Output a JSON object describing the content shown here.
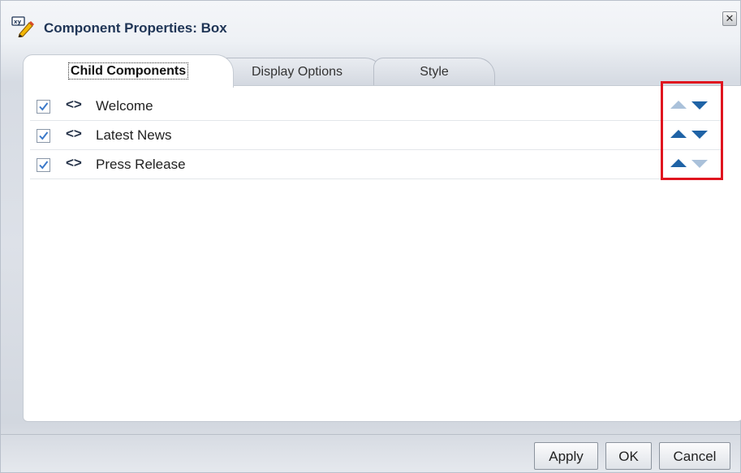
{
  "dialog": {
    "title": "Component Properties: Box",
    "title_icon": "edit-properties-icon",
    "close_icon": "close-icon",
    "close_glyph": "✕"
  },
  "tabs": [
    {
      "label": "Child Components",
      "active": true
    },
    {
      "label": "Display Options",
      "active": false
    },
    {
      "label": "Style",
      "active": false
    }
  ],
  "child_components": [
    {
      "label": "Welcome",
      "checked": true,
      "move_up_enabled": false,
      "move_down_enabled": true
    },
    {
      "label": "Latest News",
      "checked": true,
      "move_up_enabled": true,
      "move_down_enabled": true
    },
    {
      "label": "Press Release",
      "checked": true,
      "move_up_enabled": true,
      "move_down_enabled": false
    }
  ],
  "component_icon_glyph": "<>",
  "buttons": {
    "apply": "Apply",
    "ok": "OK",
    "cancel": "Cancel"
  },
  "colors": {
    "title_text": "#1f3556",
    "arrow_enabled": "#1f63a6",
    "arrow_disabled": "#aac1da",
    "highlight": "#e0151f"
  }
}
